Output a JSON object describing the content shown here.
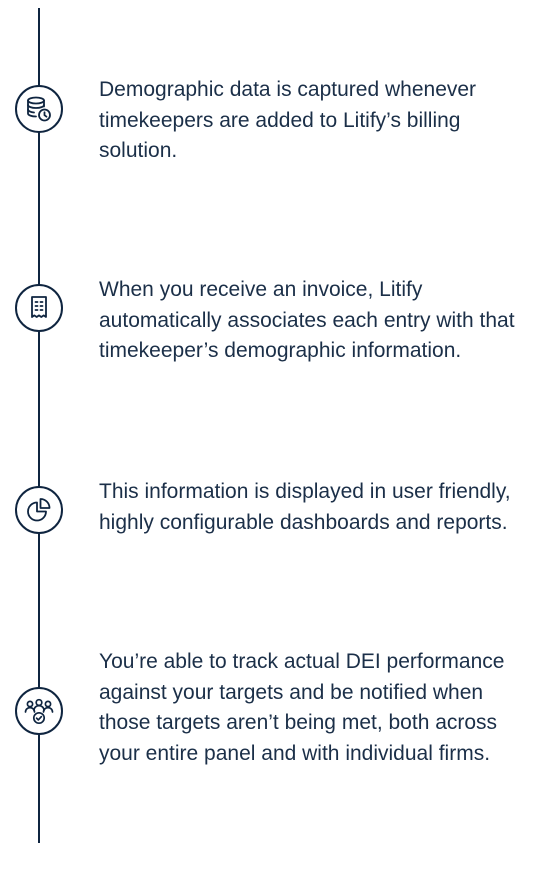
{
  "timeline": {
    "steps": [
      {
        "icon": "database-clock-icon",
        "text": "Demographic data is captured whenever timekeepers are added to Litify’s billing solution."
      },
      {
        "icon": "receipt-icon",
        "text": "When you receive an invoice, Litify automatically associates each entry with that timekeeper’s demographic information."
      },
      {
        "icon": "pie-chart-icon",
        "text": "This information is displayed in user friendly, highly configurable dashboards and reports."
      },
      {
        "icon": "team-check-icon",
        "text": "You’re able to track actual DEI performance against your targets and be notified when those targets aren’t being met, both across your entire panel and with individual firms."
      }
    ]
  }
}
